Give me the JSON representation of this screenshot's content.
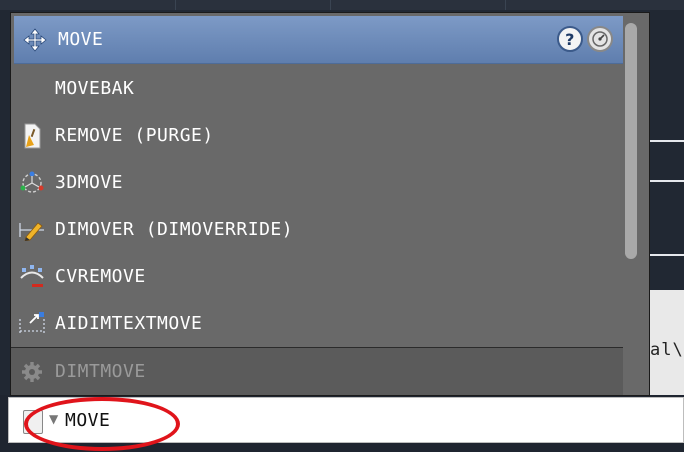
{
  "autocomplete": {
    "items": [
      {
        "label": "MOVE",
        "icon": "move-arrows-icon",
        "highlighted": true
      },
      {
        "label": "MOVEBAK",
        "icon": "",
        "highlighted": false
      },
      {
        "label": "REMOVE (PURGE)",
        "icon": "purge-broom-icon",
        "highlighted": false
      },
      {
        "label": "3DMOVE",
        "icon": "3d-move-gizmo-icon",
        "highlighted": false
      },
      {
        "label": "DIMOVER (DIMOVERRIDE)",
        "icon": "dim-override-pencil-icon",
        "highlighted": false
      },
      {
        "label": "CVREMOVE",
        "icon": "cv-remove-icon",
        "highlighted": false
      },
      {
        "label": "AIDIMTEXTMOVE",
        "icon": "dim-text-move-icon",
        "highlighted": false
      },
      {
        "label": "DIMTMOVE",
        "icon": "gear-icon",
        "highlighted": false,
        "disabled": true
      }
    ],
    "header_buttons": {
      "help": "?",
      "icons": [
        "help-icon",
        "dashboard-icon"
      ]
    }
  },
  "side_text": "al\\",
  "command_line": {
    "value": "MOVE",
    "icon": "command-line-icon"
  },
  "colors": {
    "highlight": "#6c89b8",
    "list_bg": "#696969",
    "annotation": "#e0141b"
  }
}
